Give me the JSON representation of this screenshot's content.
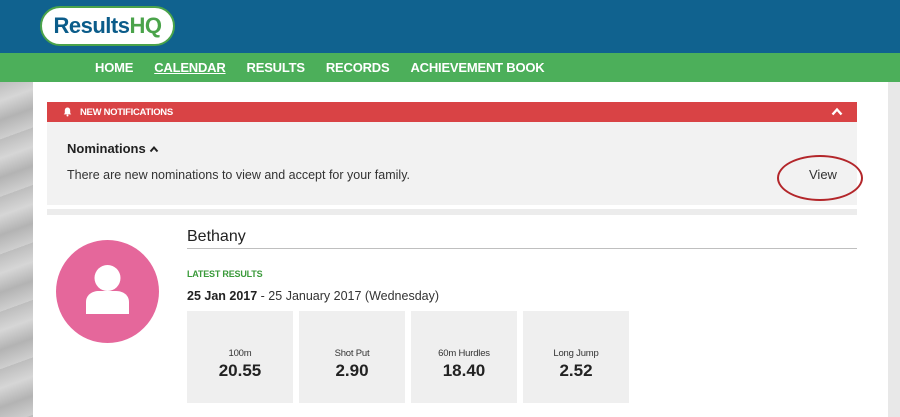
{
  "header": {
    "logo_part1": "Results",
    "logo_part2": "HQ"
  },
  "nav": {
    "items": [
      {
        "label": "HOME"
      },
      {
        "label": "CALENDAR"
      },
      {
        "label": "RESULTS"
      },
      {
        "label": "RECORDS"
      },
      {
        "label": "ACHIEVEMENT BOOK"
      }
    ],
    "active": "CALENDAR"
  },
  "notifications": {
    "bar_label": "NEW NOTIFICATIONS",
    "section_title": "Nominations",
    "message": "There are new nominations to view and accept for your family.",
    "view_label": "View"
  },
  "athlete": {
    "name": "Bethany",
    "latest_label": "LATEST RESULTS",
    "date_bold": "25 Jan 2017",
    "date_rest": " - 25 January 2017 (Wednesday)",
    "results": [
      {
        "event": "100m",
        "value": "20.55"
      },
      {
        "event": "Shot Put",
        "value": "2.90"
      },
      {
        "event": "60m Hurdles",
        "value": "18.40"
      },
      {
        "event": "Long Jump",
        "value": "2.52"
      }
    ]
  },
  "colors": {
    "header_blue": "#10628f",
    "nav_green": "#4caf5a",
    "alert_red": "#d94345",
    "avatar_pink": "#e5679b",
    "label_green": "#3a9a3a"
  }
}
